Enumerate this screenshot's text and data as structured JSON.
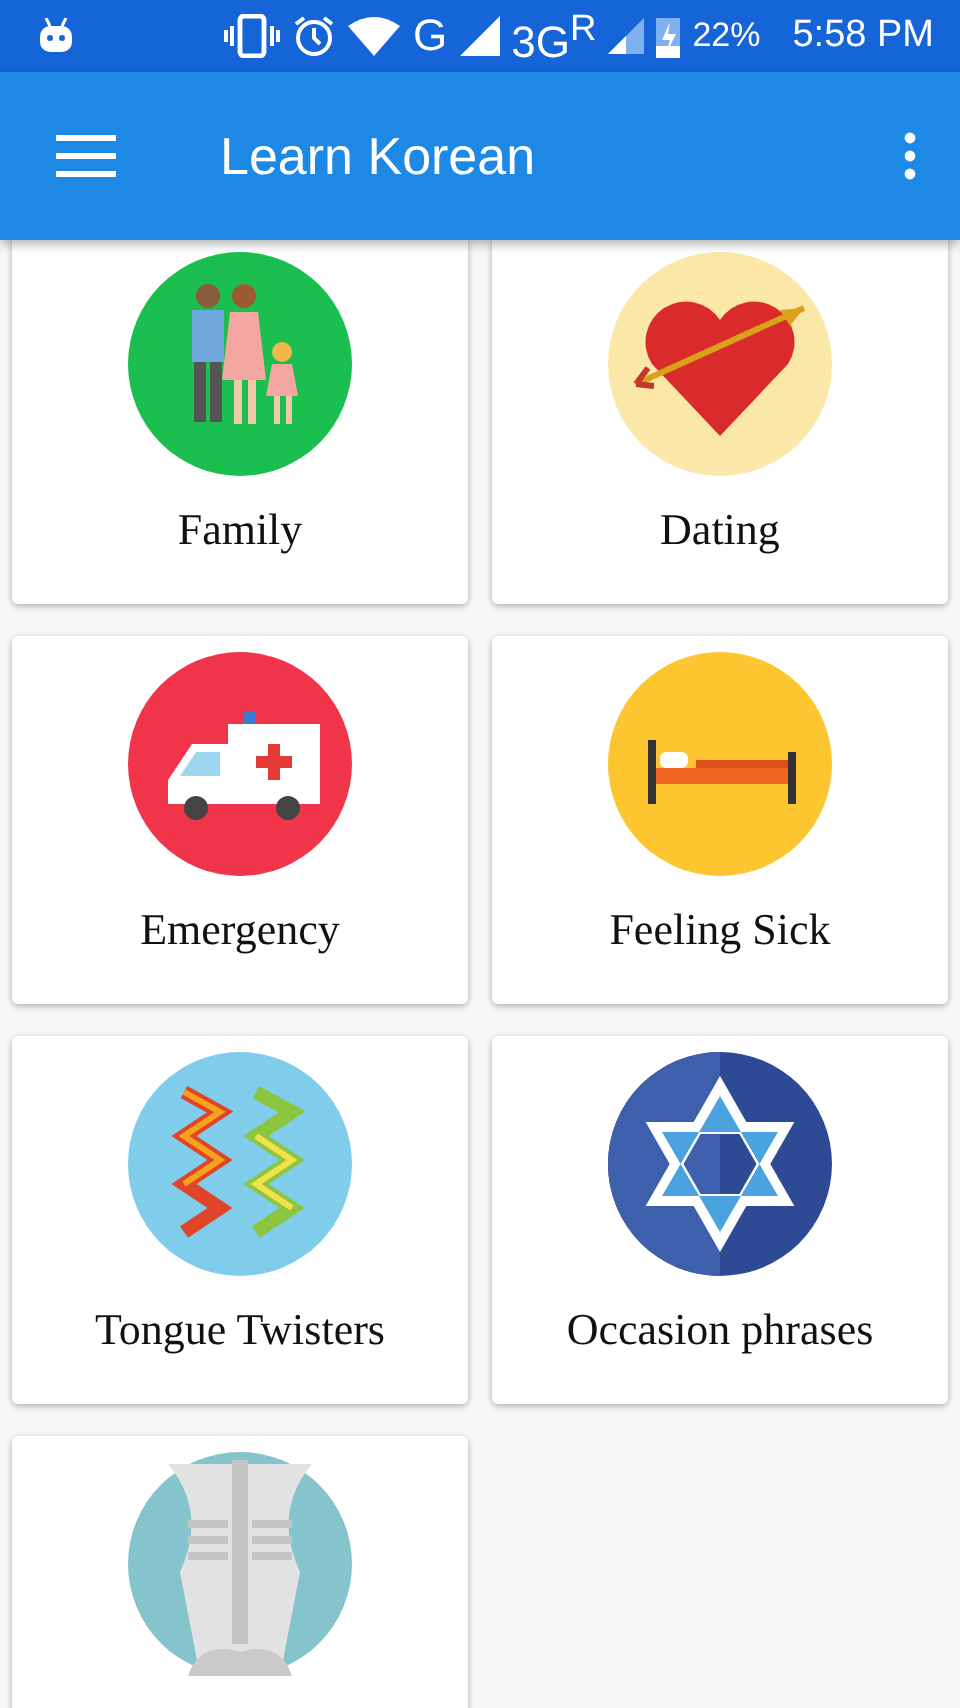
{
  "status_bar": {
    "network_1": "G",
    "network_2": "3G$^{R}$",
    "battery": "22%",
    "time": "5:58 PM"
  },
  "app_bar": {
    "title": "Learn Korean"
  },
  "categories": [
    {
      "label": "Family",
      "kind": "family"
    },
    {
      "label": "Dating",
      "kind": "heart"
    },
    {
      "label": "Emergency",
      "kind": "ambulance"
    },
    {
      "label": "Feeling Sick",
      "kind": "bed"
    },
    {
      "label": "Tongue Twisters",
      "kind": "zigzag"
    },
    {
      "label": "Occasion phrases",
      "kind": "star"
    },
    {
      "kind": "torso"
    }
  ]
}
